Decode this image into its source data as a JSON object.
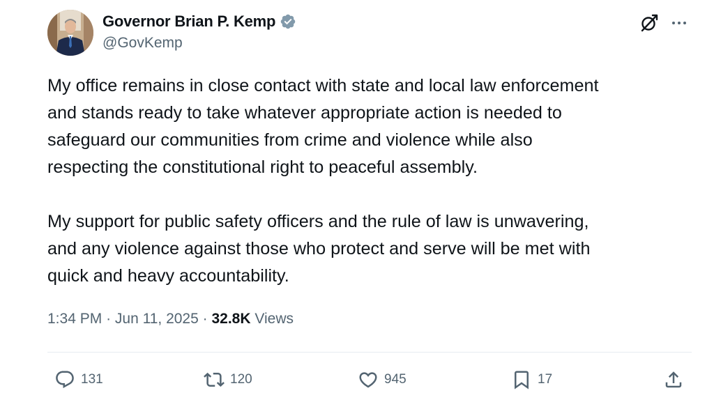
{
  "author": {
    "display_name": "Governor Brian P. Kemp",
    "handle": "@GovKemp",
    "verified": true,
    "verified_color": "#829aab"
  },
  "tweet": {
    "paragraphs": [
      "My office remains in close contact with state and local law enforcement\nand stands ready to take whatever appropriate action is needed to\nsafeguard our communities from crime and violence while also\nrespecting the constitutional right to peaceful assembly.",
      "My support for public safety officers and the rule of law is unwavering,\nand any violence against those who protect and serve will be met with\nquick and heavy accountability."
    ],
    "time": "1:34 PM",
    "separator": "·",
    "date": "Jun 11, 2025",
    "views_count": "32.8K",
    "views_label": "Views"
  },
  "actions": {
    "replies": "131",
    "retweets": "120",
    "likes": "945",
    "bookmarks": "17"
  },
  "icons": {
    "header": [
      "grok-icon",
      "more-icon"
    ],
    "actions": [
      "reply-icon",
      "retweet-icon",
      "like-icon",
      "bookmark-icon",
      "share-icon"
    ]
  },
  "colors": {
    "text": "#0f1419",
    "secondary": "#536471",
    "divider": "#e6ecf0"
  }
}
